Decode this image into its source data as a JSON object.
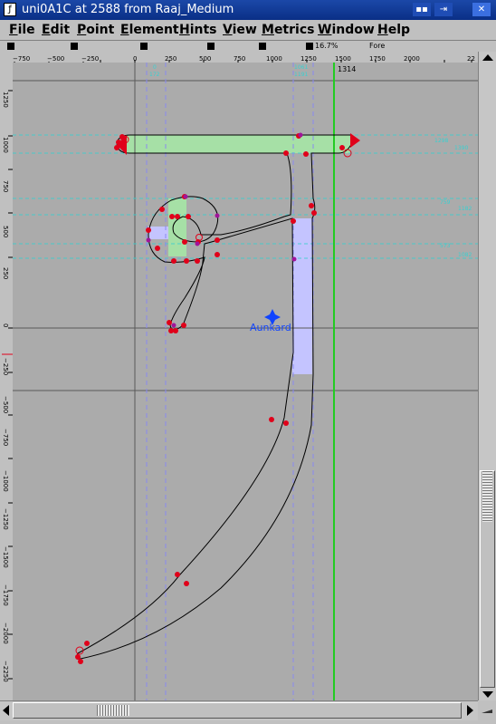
{
  "window": {
    "title": "uni0A1C at 2588 from Raaj_Medium",
    "sys_icon": "font-glyph-icon",
    "sys_icon_glyph": "ƒ",
    "buttons": [
      {
        "name": "iconify-button",
        "glyph": "▪▪"
      },
      {
        "name": "maximize-button",
        "glyph": "⇥"
      },
      {
        "name": "close-button",
        "glyph": "✕"
      }
    ]
  },
  "menu": [
    {
      "first": "F",
      "rest": "ile"
    },
    {
      "first": "E",
      "rest": "dit"
    },
    {
      "first": "P",
      "rest": "oint"
    },
    {
      "first": "E",
      "rest": "lement"
    },
    {
      "first": "H",
      "rest": "ints"
    },
    {
      "first": "V",
      "rest": "iew"
    },
    {
      "first": "M",
      "rest": "etrics"
    },
    {
      "first": "W",
      "rest": "indow"
    },
    {
      "first": "H",
      "rest": "elp"
    }
  ],
  "layers": {
    "zoom": "16.7%",
    "layer_name": "Fore"
  },
  "ruler": {
    "x_ticks": [
      "−750",
      "−500",
      "−250",
      "0",
      "250",
      "500",
      "750",
      "1000",
      "1250",
      "1500",
      "1750",
      "2000",
      "22"
    ],
    "y_ticks": [
      "1250",
      "1000",
      "750",
      "500",
      "250",
      "0",
      "−250",
      "−500",
      "−750",
      "−1000",
      "−1250",
      "−1500",
      "−1750",
      "−2000",
      "−2250"
    ]
  },
  "glyph": {
    "advance_width_label": "1314",
    "anchor_label": "Aunkard",
    "hint_labels": {
      "top_left": "0",
      "top_left2": "172",
      "top_right1": "1061",
      "top_right2": "1191",
      "right_1a": "1298",
      "right_1b": "1390",
      "right_2a": "759",
      "right_2b": "1182",
      "right_3a": "573",
      "right_3b": "1082",
      "right_4a": "468",
      "right_4b": "1002"
    }
  },
  "colors": {
    "canvas": "#ababab",
    "point": "#e0001a",
    "hint_green": "#a6e0a6",
    "hint_blue": "#c4c4ff",
    "guide_cyan": "#3ad0d0",
    "advance_green": "#22cc22",
    "anchor_blue": "#1044ff",
    "title_bar": "#0a2f86"
  }
}
